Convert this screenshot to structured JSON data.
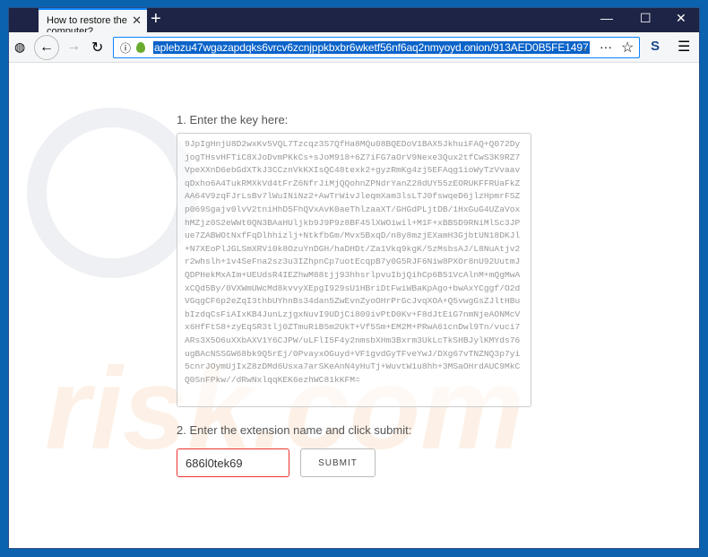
{
  "browser": {
    "tab_title": "How to restore the computer?",
    "url": "aplebzu47wgazapdqks6vrcv6zcnjppkbxbr6wketf56nf6aq2nmyoyd.onion/913AED0B5FE1497"
  },
  "page": {
    "step1": "1. Enter the key here:",
    "key": "9JpIgHnjU8D2wxKv5VQL7Tzcqz3S7QfHa8MQu08BQEDoV1BAX5JkhuiFAQ+Q072DyjogTHsvHFTiC8XJoDvmPKkCs+sJoM918+6Z7iFG7aOrV9Nexe3Qux2tfCwS3K9RZ7VpeXXnD6ebGdXTkJ3CCznVkKXIsQC48texk2+gyzRmKg4zj5EFAqg1ioWyTzVvaavqDxho6A4TukRMXkVd4tFrZ6NfrJiMjQQohnZPNdrYanZ28dUY55zEORUKFFRUaFkZAA64V9zqFJrLsBv7lWuINiNz2+AwTrWivJleqmXam3lsLTJ0fswqeD6jlzHpmrFSZp069Sgajv0lvV2tniHhD5FhQVxAvK0aeThlzaaXT/GHGdPLjtDB/1HxGuG4UZaVoxhMZjz0S2eWWt0QN3BAaHUljkb9J9P9z8BF45lXWOiwil+M1F+xBB5D9RNiMlSc3JPue7ZABWOtNxfFqDlhhizlj+NtkfbGm/Mvx5BxqD/n8y8mzjEXamH3GjbtUN18DKJl+N7XEoPlJGLSmXRVi0k8OzuYnDGH/haDHDt/Za1Vkq9kgK/5zMsbsAJ/L8NuAtjv2r2whslh+1v4SeFna2sz3u3IZhpnCp7uotEcqpB7y0G5RJF6Niw8PXOr8nU92UutmJQDPHekMxAIm+UEUdsR4IEZhwM88tjj93hhsrlpvuIbjQihCp6B51VcAlnM+mQgMwAxCQd5By/0VXWmUWcMd8kvvyXEpgI929sU1HBriDtFwiWBaKpAgo+bwAxYCggf/O2dVGqgCF6p2eZqI3thbUYhnBs34dan5ZwEvnZyoOHrPrGcJvqXOA+Q5vwgGsZJltHBubIzdqCsFiAIxKB4JunLzjgxNuvI9UDjCi809ivPtD0Kv+F8dJtEiG7nmNjeAONMcVx6HfFtS8+zyEqSR3tlj0ZTmuRiB5m2UkT+Vf5Sm+EM2M+PRwA61cnDwl9Tn/vuci7ARs3X5O6uXXbAXV1Y6CJPW/uLFlI5F4y2nmsbXHm3Bxrm3UkLcTkSHBJylKMYds76ugBAcNSSGW68bk9Q5rEj/0PvayxOGuyd+VF1gvdGyTFveYwJ/DXg67vTNZNQ3p7yi5cnrJOymUjIxZ8zDMd6Usxa7arSKeAnN4yHuTj+WuvtW1u8hh+3MSaOHrdAUC9MkCQ0SnFPkw//dRwNxlqqKEK6ezhWC81kKFM=",
    "step2": "2. Enter the extension name and click submit:",
    "extension_value": "686l0tek69",
    "submit": "SUBMIT"
  }
}
